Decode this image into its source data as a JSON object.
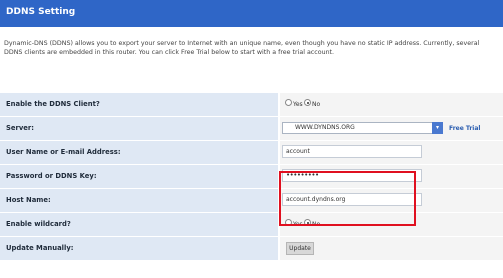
{
  "header": {
    "title": "DDNS Setting"
  },
  "description": "Dynamic-DNS (DDNS) allows you to export your server to Internet with an unique name, even though you have no static IP address. Currently, several DDNS clients are embedded in this router. You can click Free Trial below to start with a free trial account.",
  "rows": {
    "enable_ddns": {
      "label": "Enable the DDNS Client?",
      "yes": "Yes",
      "no": "No",
      "selected": "no"
    },
    "server": {
      "label": "Server:",
      "value": "WWW.DYNDNS.ORG",
      "link": "Free Trial"
    },
    "username": {
      "label": "User Name or E-mail Address:",
      "value": "account"
    },
    "password": {
      "label": "Password or DDNS Key:",
      "value": "•••••••••"
    },
    "hostname": {
      "label": "Host Name:",
      "value": "account.dyndns.org"
    },
    "wildcard": {
      "label": "Enable wildcard?",
      "yes": "Yes",
      "no": "No",
      "selected": "no"
    },
    "update": {
      "label": "Update Manually:",
      "button": "Update"
    }
  }
}
